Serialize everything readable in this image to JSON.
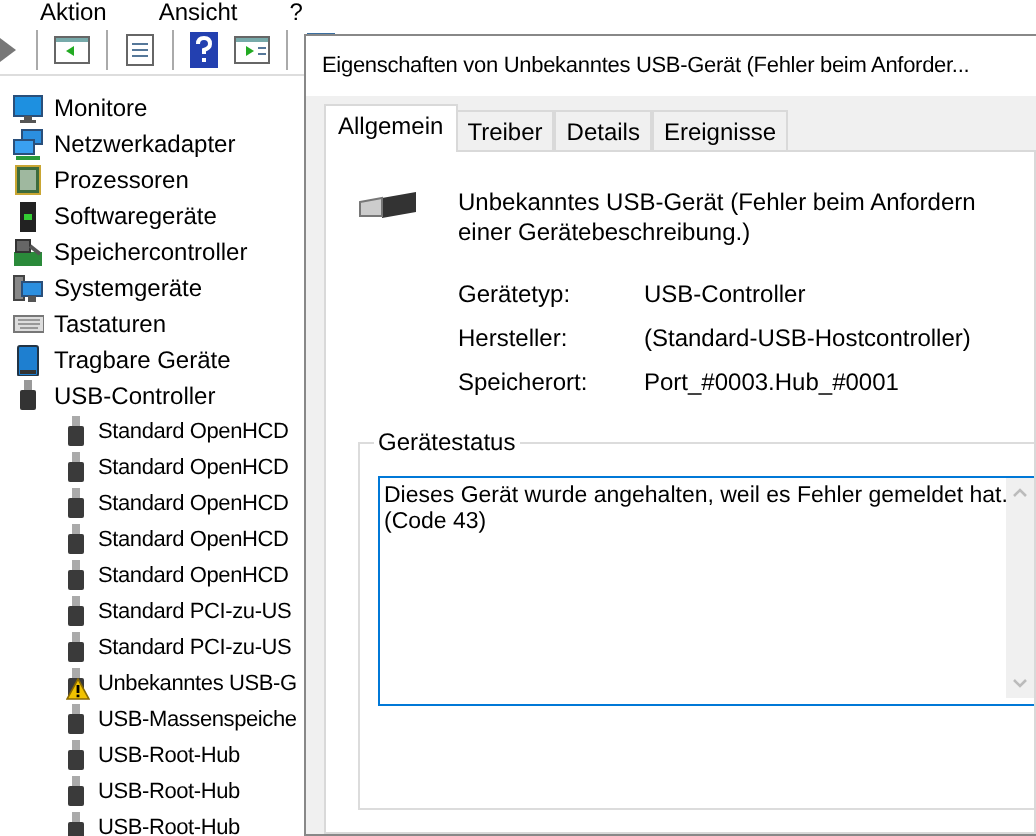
{
  "menu": [
    {
      "label": "Aktion"
    },
    {
      "label": "Ansicht"
    },
    {
      "label": "?"
    }
  ],
  "tree": [
    {
      "label": "Monitore",
      "kind": "monitor"
    },
    {
      "label": "Netzwerkadapter",
      "kind": "network"
    },
    {
      "label": "Prozessoren",
      "kind": "cpu"
    },
    {
      "label": "Softwaregeräte",
      "kind": "software"
    },
    {
      "label": "Speichercontroller",
      "kind": "storage"
    },
    {
      "label": "Systemgeräte",
      "kind": "system"
    },
    {
      "label": "Tastaturen",
      "kind": "keyboard"
    },
    {
      "label": "Tragbare Geräte",
      "kind": "portable"
    },
    {
      "label": "USB-Controller",
      "kind": "usb",
      "expanded": true,
      "children": [
        {
          "label": "Standard OpenHCD",
          "warning": false
        },
        {
          "label": "Standard OpenHCD",
          "warning": false
        },
        {
          "label": "Standard OpenHCD",
          "warning": false
        },
        {
          "label": "Standard OpenHCD",
          "warning": false
        },
        {
          "label": "Standard OpenHCD",
          "warning": false
        },
        {
          "label": "Standard PCI-zu-US",
          "warning": false
        },
        {
          "label": "Standard PCI-zu-US",
          "warning": false
        },
        {
          "label": "Unbekanntes USB-G",
          "warning": true
        },
        {
          "label": "USB-Massenspeiche",
          "warning": false
        },
        {
          "label": "USB-Root-Hub",
          "warning": false
        },
        {
          "label": "USB-Root-Hub",
          "warning": false
        },
        {
          "label": "USB-Root-Hub",
          "warning": false
        }
      ]
    }
  ],
  "dialog": {
    "title": "Eigenschaften von Unbekanntes USB-Gerät (Fehler beim Anforder...",
    "tabs": [
      {
        "label": "Allgemein",
        "selected": true
      },
      {
        "label": "Treiber",
        "selected": false
      },
      {
        "label": "Details",
        "selected": false
      },
      {
        "label": "Ereignisse",
        "selected": false
      }
    ],
    "device_name": "Unbekanntes USB-Gerät (Fehler beim Anfordern einer Gerätebeschreibung.)",
    "properties": [
      {
        "label": "Gerätetyp:",
        "value": "USB-Controller"
      },
      {
        "label": "Hersteller:",
        "value": "(Standard-USB-Hostcontroller)"
      },
      {
        "label": "Speicherort:",
        "value": "Port_#0003.Hub_#0001"
      }
    ],
    "status": {
      "title": "Gerätestatus",
      "text": "Dieses Gerät wurde angehalten, weil es Fehler gemeldet hat.\n(Code 43)"
    }
  }
}
